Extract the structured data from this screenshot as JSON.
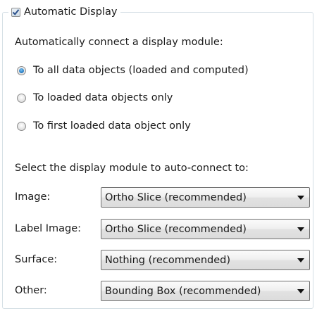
{
  "group": {
    "title": "Automatic Display",
    "checked": true
  },
  "connect_heading": "Automatically connect a display module:",
  "radio_options": [
    {
      "label": "To all data objects (loaded and computed)",
      "selected": true
    },
    {
      "label": "To loaded data objects only",
      "selected": false
    },
    {
      "label": "To first loaded data object only",
      "selected": false
    }
  ],
  "module_heading": "Select the display module to auto-connect to:",
  "fields": [
    {
      "label": "Image:",
      "value": "Ortho Slice (recommended)"
    },
    {
      "label": "Label Image:",
      "value": "Ortho Slice (recommended)"
    },
    {
      "label": "Surface:",
      "value": "Nothing (recommended)"
    },
    {
      "label": "Other:",
      "value": "Bounding Box (recommended)"
    }
  ],
  "icons": {
    "checkbox": "checkmark-icon",
    "dropdown": "triangle-down-icon",
    "radio_selected": "radio-dot-icon"
  },
  "colors": {
    "group_border": "#d5dfe5",
    "radio_selected": "#2a7fc6",
    "checkmark": "#2a4f8a"
  }
}
